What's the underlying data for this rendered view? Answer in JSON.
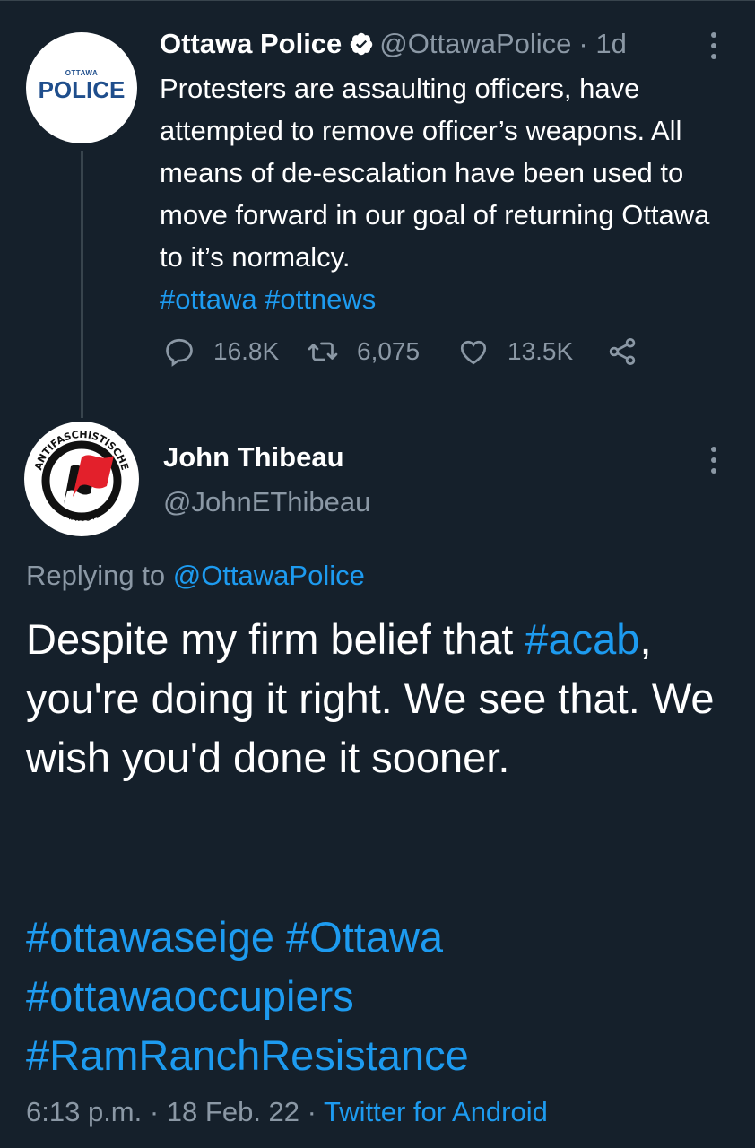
{
  "parent_tweet": {
    "avatar": {
      "small_text": "OTTAWA",
      "big_text": "POLICE"
    },
    "name": "Ottawa Police",
    "handle": "@OttawaPolice",
    "time": "· 1d",
    "text": "Protesters are assaulting officers, have attempted to remove officer’s weapons. All means of de-escalation have been used to move forward in our goal of returning Ottawa to it’s normalcy.",
    "hashtags": "#ottawa #ottnews",
    "stats": {
      "replies": "16.8K",
      "retweets": "6,075",
      "likes": "13.5K"
    }
  },
  "reply_tweet": {
    "avatar": {
      "top_text": "ANTIFASCHISTISCHE",
      "bottom_text": "AKTION"
    },
    "name": "John Thibeau",
    "handle": "@JohnEThibeau",
    "replying_prefix": "Replying to",
    "replying_to": "@OttawaPolice",
    "text_part1": "Despite my firm belief that",
    "text_hashtag": "#acab",
    "text_part2": ", you're doing it right. We see that. We wish you'd done it sooner.",
    "hashtags_line1": "#ottawaseige #Ottawa",
    "hashtags_line2": "#ottawaoccupiers",
    "hashtags_line3": "#RamRanchResistance",
    "time": "6:13 p.m.",
    "date": "· 18 Feb. 22 ·",
    "source": "Twitter for Android"
  },
  "colors": {
    "background": "#15202b",
    "accent": "#1d9bf0",
    "muted": "#8b98a5"
  },
  "icons": [
    "verified-badge-icon",
    "more-dots-icon",
    "reply-icon",
    "retweet-icon",
    "like-icon",
    "share-icon"
  ]
}
